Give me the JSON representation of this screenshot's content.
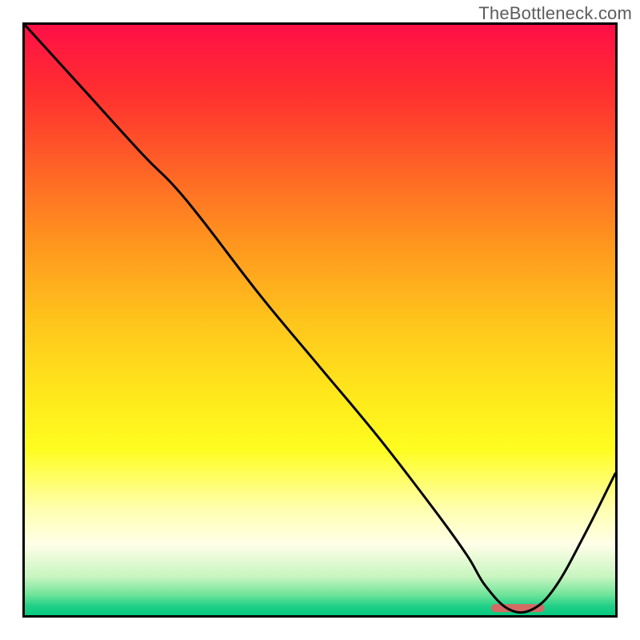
{
  "attribution": "TheBottleneck.com",
  "chart_data": {
    "type": "line",
    "title": "",
    "xlabel": "",
    "ylabel": "",
    "xlim": [
      0,
      100
    ],
    "ylim": [
      0,
      100
    ],
    "background": {
      "type": "vertical-gradient",
      "stops": [
        {
          "pos": 0.0,
          "color": "#ff0f46"
        },
        {
          "pos": 0.12,
          "color": "#ff312f"
        },
        {
          "pos": 0.35,
          "color": "#ff8e1f"
        },
        {
          "pos": 0.5,
          "color": "#ffc41c"
        },
        {
          "pos": 0.62,
          "color": "#ffe61b"
        },
        {
          "pos": 0.72,
          "color": "#fffd20"
        },
        {
          "pos": 0.82,
          "color": "#ffffb0"
        },
        {
          "pos": 0.88,
          "color": "#ffffe8"
        },
        {
          "pos": 0.935,
          "color": "#c7f5c0"
        },
        {
          "pos": 0.965,
          "color": "#6fe49a"
        },
        {
          "pos": 0.985,
          "color": "#1fcf87"
        },
        {
          "pos": 1.0,
          "color": "#05c97f"
        }
      ]
    },
    "series": [
      {
        "name": "curve",
        "color": "#000000",
        "x": [
          0,
          10,
          20,
          25,
          30,
          40,
          50,
          60,
          70,
          75,
          78,
          82,
          86,
          90,
          95,
          100
        ],
        "values": [
          100,
          89,
          78,
          73,
          67,
          54,
          42,
          30,
          17,
          10,
          5,
          1,
          1,
          5,
          14,
          24
        ]
      }
    ],
    "marker": {
      "name": "optimum-band",
      "shape": "rounded-rect",
      "color": "#d36a63",
      "x_range": [
        79,
        88
      ],
      "y": 1.2
    }
  }
}
